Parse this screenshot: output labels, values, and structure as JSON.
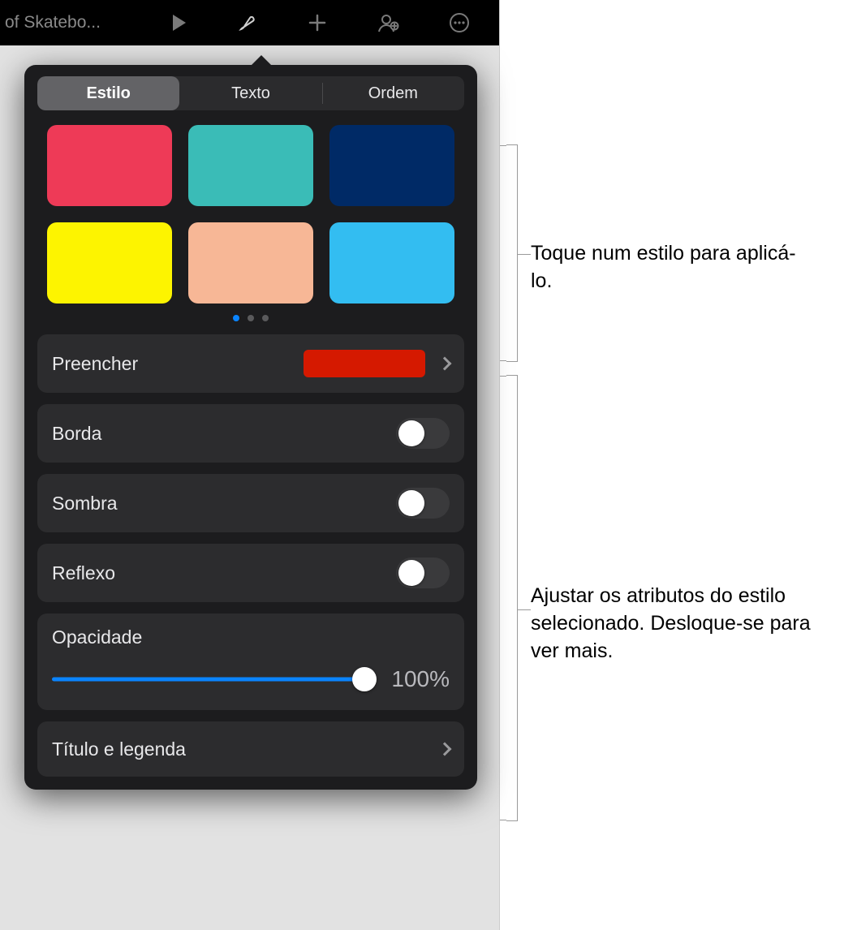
{
  "topbar": {
    "document_title": "of Skatebo..."
  },
  "tabs": {
    "style": "Estilo",
    "text": "Texto",
    "order": "Ordem",
    "selected": "style"
  },
  "swatches": [
    "#ee3a57",
    "#3abcb7",
    "#002a66",
    "#fdf400",
    "#f7b796",
    "#33bdf1"
  ],
  "page_dots": {
    "count": 3,
    "active": 0
  },
  "rows": {
    "fill": {
      "label": "Preencher",
      "color": "#d51900"
    },
    "border": {
      "label": "Borda",
      "on": false
    },
    "shadow": {
      "label": "Sombra",
      "on": false
    },
    "reflect": {
      "label": "Reflexo",
      "on": false
    },
    "opacity": {
      "label": "Opacidade",
      "value": "100%"
    },
    "title": {
      "label": "Título e legenda"
    }
  },
  "callouts": {
    "c1": "Toque num estilo para aplicá-lo.",
    "c2": "Ajustar os atributos do estilo selecionado. Desloque-se para ver mais."
  }
}
